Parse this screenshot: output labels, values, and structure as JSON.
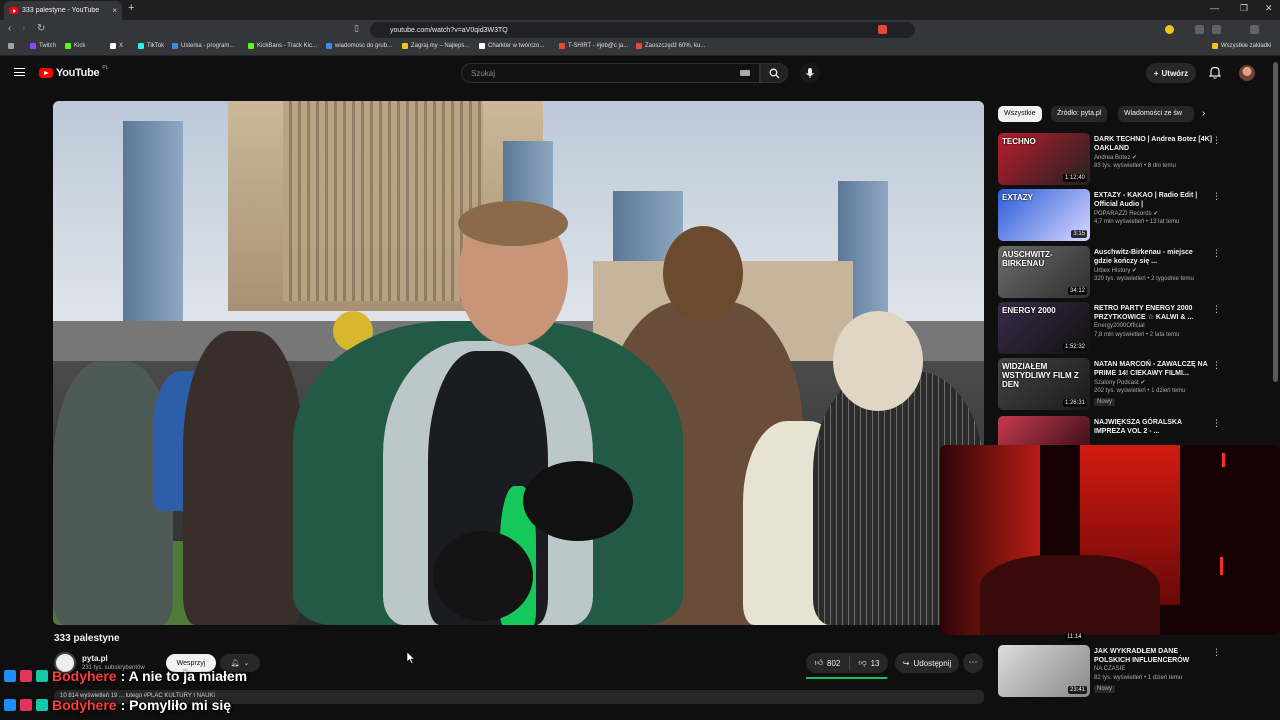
{
  "browser": {
    "tab_title": "333 palestyne - YouTube",
    "tab_close": "×",
    "new_tab": "+",
    "url": "youtube.com/watch?v=aV0qid3W3TQ",
    "window_controls": [
      "—",
      "❐",
      "✕"
    ],
    "bookmarks": [
      "Twitch",
      "Kick",
      "X",
      "TikTok",
      "Usterka - program...",
      "KickBans - Track Kic...",
      "wiadomosc do grub...",
      "Zagraj.my – Najleps...",
      "Charkter w twórczo...",
      "T-SHIRT - #jeb@c ja...",
      "Zaoszczędź 60%, ku..."
    ],
    "bookmarks_folder": "Wszystkie zakładki"
  },
  "youtube_header": {
    "logo_text": "YouTube",
    "country_code": "PL",
    "search_placeholder": "Szukaj",
    "create_label": "Utwórz"
  },
  "video": {
    "title": "333 palestyne",
    "channel_name": "pyta.pl",
    "channel_subs": "231 tys. subskrybentów",
    "support_label": "Wesprzyj",
    "likes": "802",
    "dislikes": "13",
    "like_ratio": 0.984,
    "share_label": "Udostępnij",
    "more_label": "⋯",
    "description_snippet": "10 814 wyświetleń  19 ... lutego  #PLAC KULTURY I NAUKI"
  },
  "chat": [
    {
      "user": "Bodyhere",
      "message": ": A nie to ja miałem"
    },
    {
      "user": "Bodyhere",
      "message": ": Pomyliło mi się"
    }
  ],
  "sidebar": {
    "chips": [
      "Wszystkie",
      "Źródło: pyta.pl",
      "Wiadomości ze św"
    ],
    "chip_next": "›",
    "recommendations": [
      {
        "title": "DARK TECHNO | Andrea Botez [4K] OAKLAND",
        "channel": "Andrea Botez ✔",
        "meta": "83 tys. wyświetleń • 8 dni temu",
        "duration": "1:12:40",
        "thumb_text": "TECHNO",
        "colors": [
          "#b81d2b",
          "#222"
        ],
        "badge": ""
      },
      {
        "title": "EXTAZY - KAKAO | Radio Edit | Official Audio |",
        "channel": "POPARAZZI Records ✔",
        "meta": "4,7 mln wyświetleń • 13 lat temu",
        "duration": "3:15",
        "thumb_text": "EXTAZY",
        "colors": [
          "#2a5bd7",
          "#d8d8ff"
        ],
        "badge": ""
      },
      {
        "title": "Auschwitz-Birkenau - miejsce gdzie kończy się ...",
        "channel": "Urbex History ✔",
        "meta": "320 tys. wyświetleń • 2 tygodnie temu",
        "duration": "34:12",
        "thumb_text": "AUSCHWITZ-BIRKENAU",
        "colors": [
          "#6b6b6b",
          "#2e2e2e"
        ],
        "badge": ""
      },
      {
        "title": "RETRO PARTY ENERGY 2000 PRZYTKOWICE ☆ KALWI & ...",
        "channel": "Energy2000Official",
        "meta": "7,8 mln wyświetleń • 2 lata temu",
        "duration": "1:52:32",
        "thumb_text": "ENERGY 2000",
        "colors": [
          "#3a2a4a",
          "#111"
        ],
        "badge": ""
      },
      {
        "title": "NATAN MARCOŃ - ZAWALCZĘ NA PRIME 14! CIEKAWY FILMI...",
        "channel": "Szalony Podcast ✔",
        "meta": "202 tys. wyświetleń • 1 dzień temu",
        "duration": "1:26:31",
        "thumb_text": "WIDZIAŁEM WSTYDLIWY FILM Z DEN",
        "colors": [
          "#444",
          "#1a1a1a"
        ],
        "badge": "Nowy"
      },
      {
        "title": "NAJWIĘKSZA GÓRALSKA IMPREZA VOL 2 - ...",
        "channel": "",
        "meta": "",
        "duration": "",
        "thumb_text": "",
        "colors": [
          "#c43a4f",
          "#2a0a10"
        ],
        "badge": ""
      },
      {
        "title": "JAK WYKRADŁEM DANE POLSKICH INFLUENCERÓW",
        "channel": "NA CZASIE",
        "meta": "82 tys. wyświetleń • 1 dzień temu",
        "duration": "23:41",
        "thumb_text": "",
        "colors": [
          "#ddd",
          "#888"
        ],
        "badge": "Nowy"
      }
    ],
    "hidden_duration": "11:14"
  },
  "colors": {
    "accent_red": "#ff0000",
    "chat_user": "#ff3b3b",
    "like_bar": "#1fbf5f"
  }
}
